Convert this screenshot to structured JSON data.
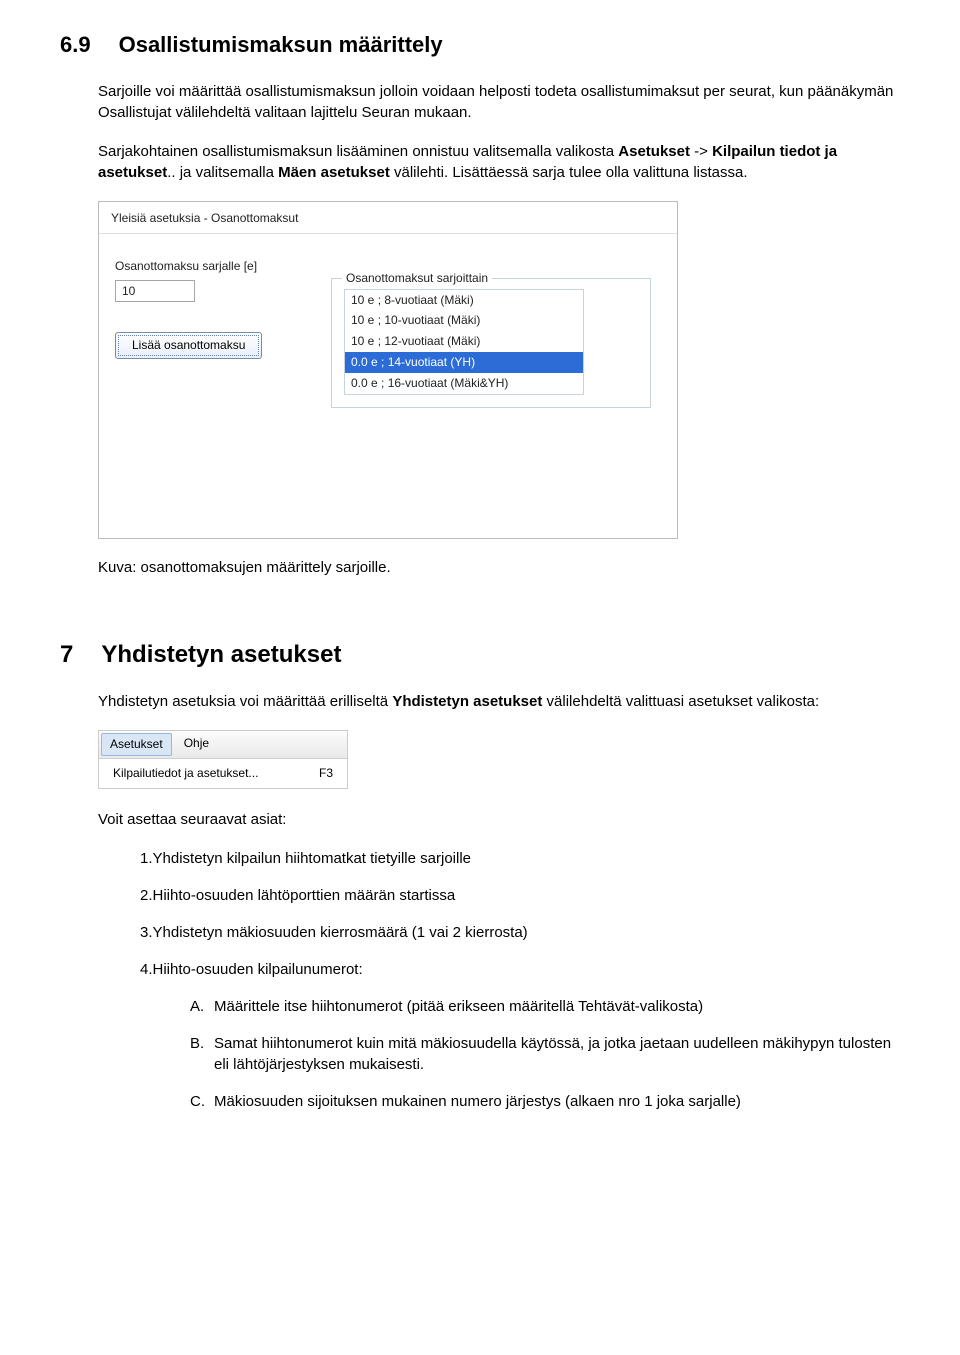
{
  "section1": {
    "number": "6.9",
    "title": "Osallistumismaksun määrittely",
    "para1": "Sarjoille voi määrittää osallistumismaksun jolloin voidaan helposti todeta osallistumimaksut per seurat, kun päänäkymän Osallistujat välilehdeltä valitaan lajittelu Seuran mukaan.",
    "para2a": "Sarjakohtainen osallistumismaksun lisääminen onnistuu valitsemalla valikosta ",
    "para2b_bold": "Asetukset",
    "para2c": " -> ",
    "para2d_bold": "Kilpailun tiedot ja asetukset",
    "para2e": ".. ja valitsemalla ",
    "para2f_bold": "Mäen asetukset",
    "para2g": " välilehti. Lisättäessä sarja tulee olla valittuna listassa."
  },
  "dialog": {
    "title": "Yleisiä asetuksia - Osanottomaksut",
    "fee_label": "Osanottomaksu sarjalle [e]",
    "fee_value": "10",
    "button": "Lisää osanottomaksu",
    "fieldset_label": "Osanottomaksut sarjoittain",
    "items": [
      "10 e ; 8-vuotiaat (Mäki)",
      "10 e ; 10-vuotiaat (Mäki)",
      "10 e ; 12-vuotiaat (Mäki)",
      "0.0 e ; 14-vuotiaat (YH)",
      "0.0 e ; 16-vuotiaat (Mäki&YH)"
    ],
    "selected_index": 3
  },
  "caption1": "Kuva: osanottomaksujen määrittely sarjoille.",
  "section2": {
    "number": "7",
    "title": "Yhdistetyn asetukset",
    "para1a": "Yhdistetyn asetuksia voi määrittää erilliseltä ",
    "para1b_bold": "Yhdistetyn asetukset",
    "para1c": " välilehdeltä valittuasi asetukset valikosta:"
  },
  "menuimg": {
    "menu1": "Asetukset",
    "menu2": "Ohje",
    "item": "Kilpailutiedot ja asetukset...",
    "shortcut": "F3"
  },
  "para_after_menu": "Voit asettaa seuraavat asiat:",
  "numbered": [
    "1.Yhdistetyn kilpailun hiihtomatkat tietyille sarjoille",
    "2.Hiihto-osuuden lähtöporttien määrän startissa",
    "3.Yhdistetyn mäkiosuuden kierrosmäärä (1 vai 2 kierrosta)",
    "4.Hiihto-osuuden kilpailunumerot:"
  ],
  "alpha": [
    {
      "l": "A.",
      "t": "Määrittele itse hiihtonumerot (pitää erikseen määritellä Tehtävät-valikosta)"
    },
    {
      "l": "B.",
      "t": "Samat hiihtonumerot kuin mitä mäkiosuudella käytössä, ja jotka jaetaan uudelleen mäkihypyn tulosten eli lähtöjärjestyksen mukaisesti."
    },
    {
      "l": "C.",
      "t": "Mäkiosuuden sijoituksen mukainen numero järjestys (alkaen nro 1 joka sarjalle)"
    }
  ]
}
